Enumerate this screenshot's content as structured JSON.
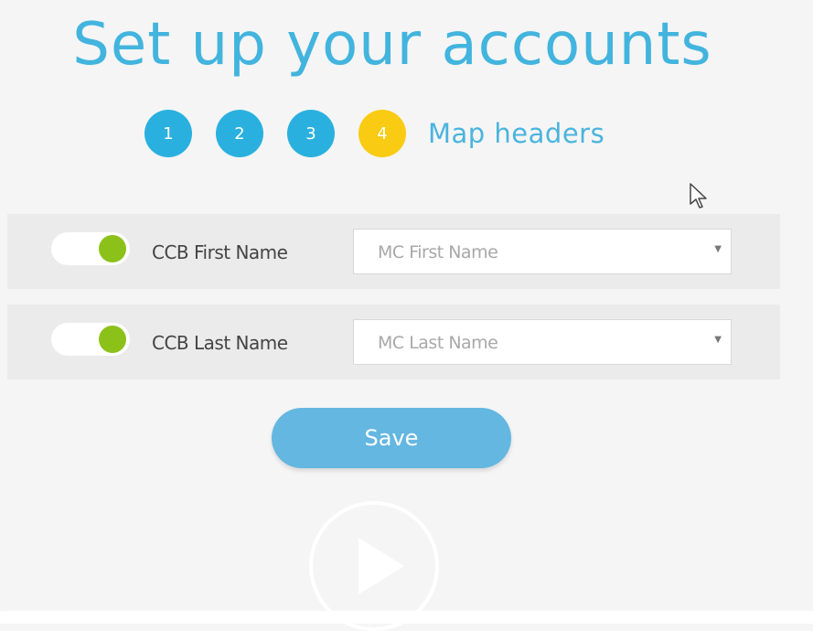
{
  "page": {
    "title": "Set up your accounts"
  },
  "steps": [
    {
      "number": "1",
      "state": "done"
    },
    {
      "number": "2",
      "state": "done"
    },
    {
      "number": "3",
      "state": "done"
    },
    {
      "number": "4",
      "state": "current"
    }
  ],
  "step_label": "Map headers",
  "mappings": [
    {
      "toggle_on": true,
      "source_label": "CCB First Name",
      "target_value": "MC First Name"
    },
    {
      "toggle_on": true,
      "source_label": "CCB Last Name",
      "target_value": "MC Last Name"
    }
  ],
  "save_label": "Save",
  "colors": {
    "accent": "#42b4de",
    "step_done": "#2ab0df",
    "step_current": "#f9cb13",
    "toggle_on": "#8cc11a",
    "save": "#63b7e1"
  },
  "icons": {
    "play": "play-icon",
    "cursor": "mouse-cursor-icon",
    "caret": "caret-down-icon"
  }
}
